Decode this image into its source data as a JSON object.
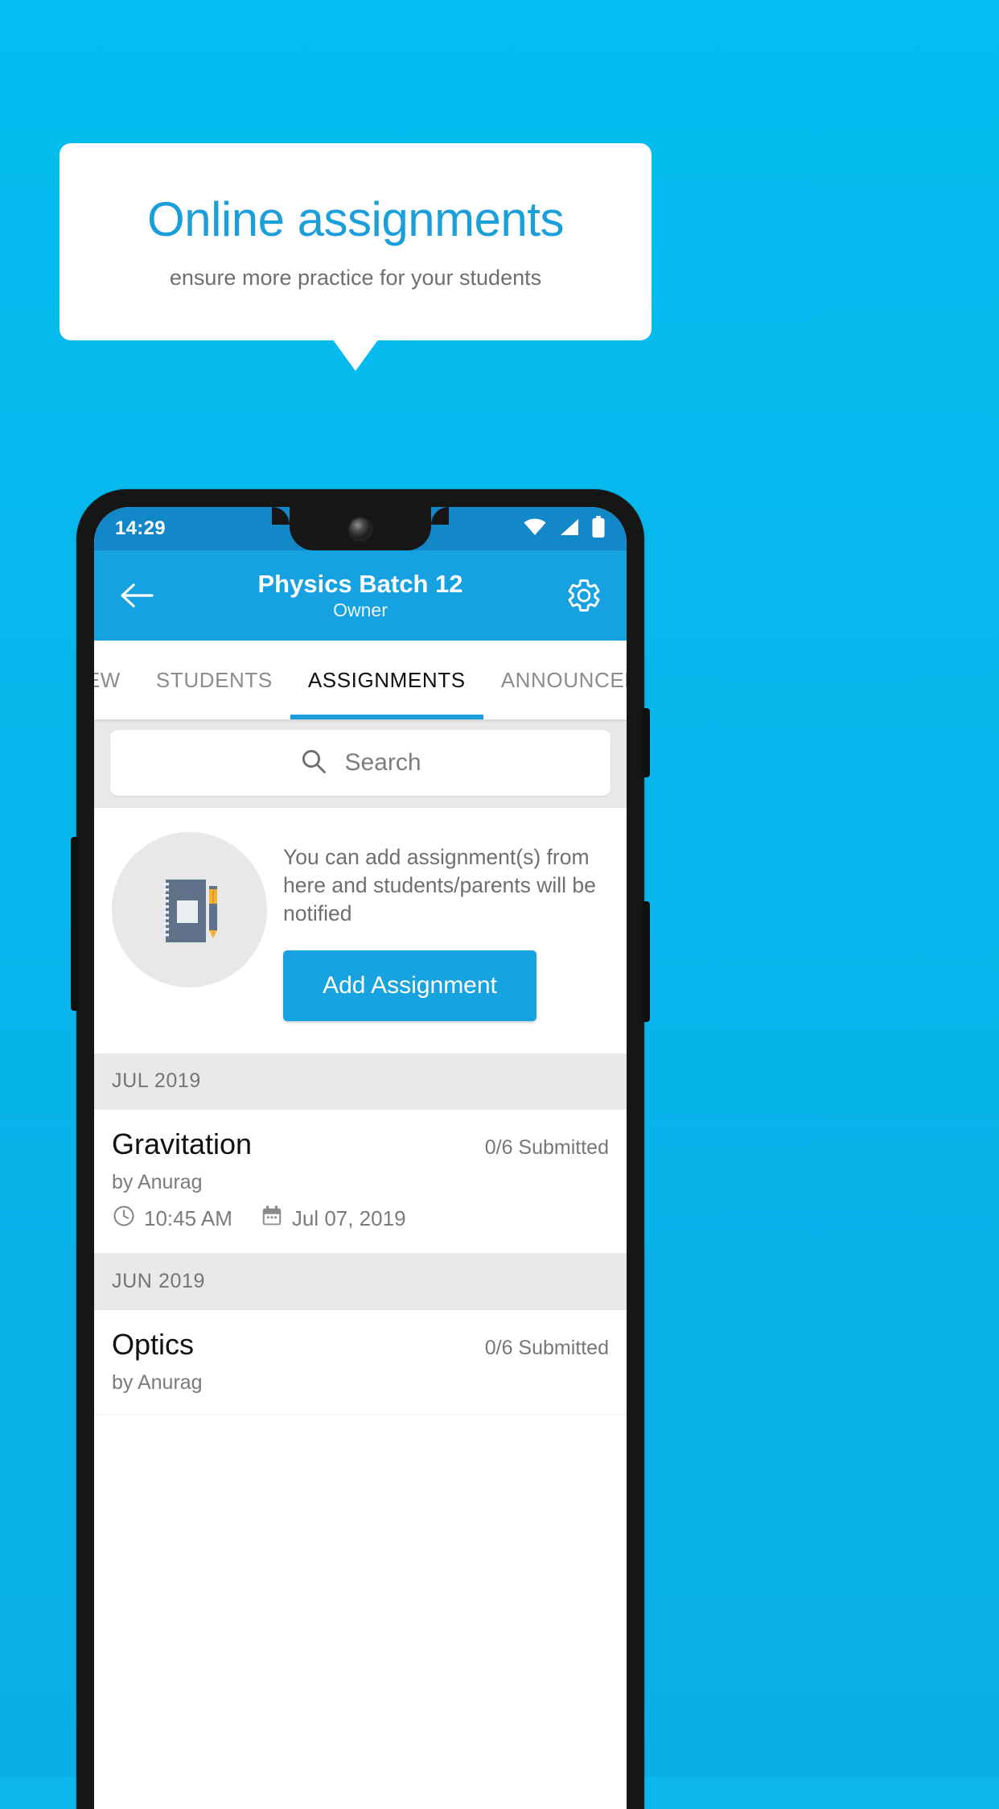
{
  "promo": {
    "title": "Online assignments",
    "subtitle": "ensure more practice for your students"
  },
  "colors": {
    "background": "#06b6ec",
    "accent": "#1b9fdb",
    "appbar": "#16a2e0",
    "statusbar": "#1288c9",
    "button": "#17a2e0",
    "section_header_bg": "#e9e9e9"
  },
  "phone": {
    "statusbar": {
      "time": "14:29",
      "icons": [
        "wifi-icon",
        "cellular-signal-icon",
        "battery-icon"
      ]
    },
    "appbar": {
      "back_icon": "back-arrow-icon",
      "title": "Physics Batch 12",
      "subtitle": "Owner",
      "settings_icon": "gear-icon"
    },
    "tabs": [
      {
        "label": "IEW",
        "active": false
      },
      {
        "label": "STUDENTS",
        "active": false
      },
      {
        "label": "ASSIGNMENTS",
        "active": true
      },
      {
        "label": "ANNOUNCEMENTS",
        "active": false
      }
    ],
    "search": {
      "icon": "search-icon",
      "placeholder": "Search",
      "value": ""
    },
    "empty_state": {
      "illustration": "notebook-and-pen-icon",
      "message": "You can add assignment(s) from here and students/parents will be notified",
      "button_label": "Add Assignment"
    },
    "sections": [
      {
        "header": "JUL 2019",
        "items": [
          {
            "title": "Gravitation",
            "submitted": "0/6 Submitted",
            "author": "by Anurag",
            "time_icon": "clock-icon",
            "time": "10:45 AM",
            "date_icon": "calendar-icon",
            "date": "Jul 07, 2019"
          }
        ]
      },
      {
        "header": "JUN 2019",
        "items": [
          {
            "title": "Optics",
            "submitted": "0/6 Submitted",
            "author": "by Anurag",
            "time_icon": "clock-icon",
            "time": "",
            "date_icon": "calendar-icon",
            "date": ""
          }
        ]
      }
    ]
  }
}
